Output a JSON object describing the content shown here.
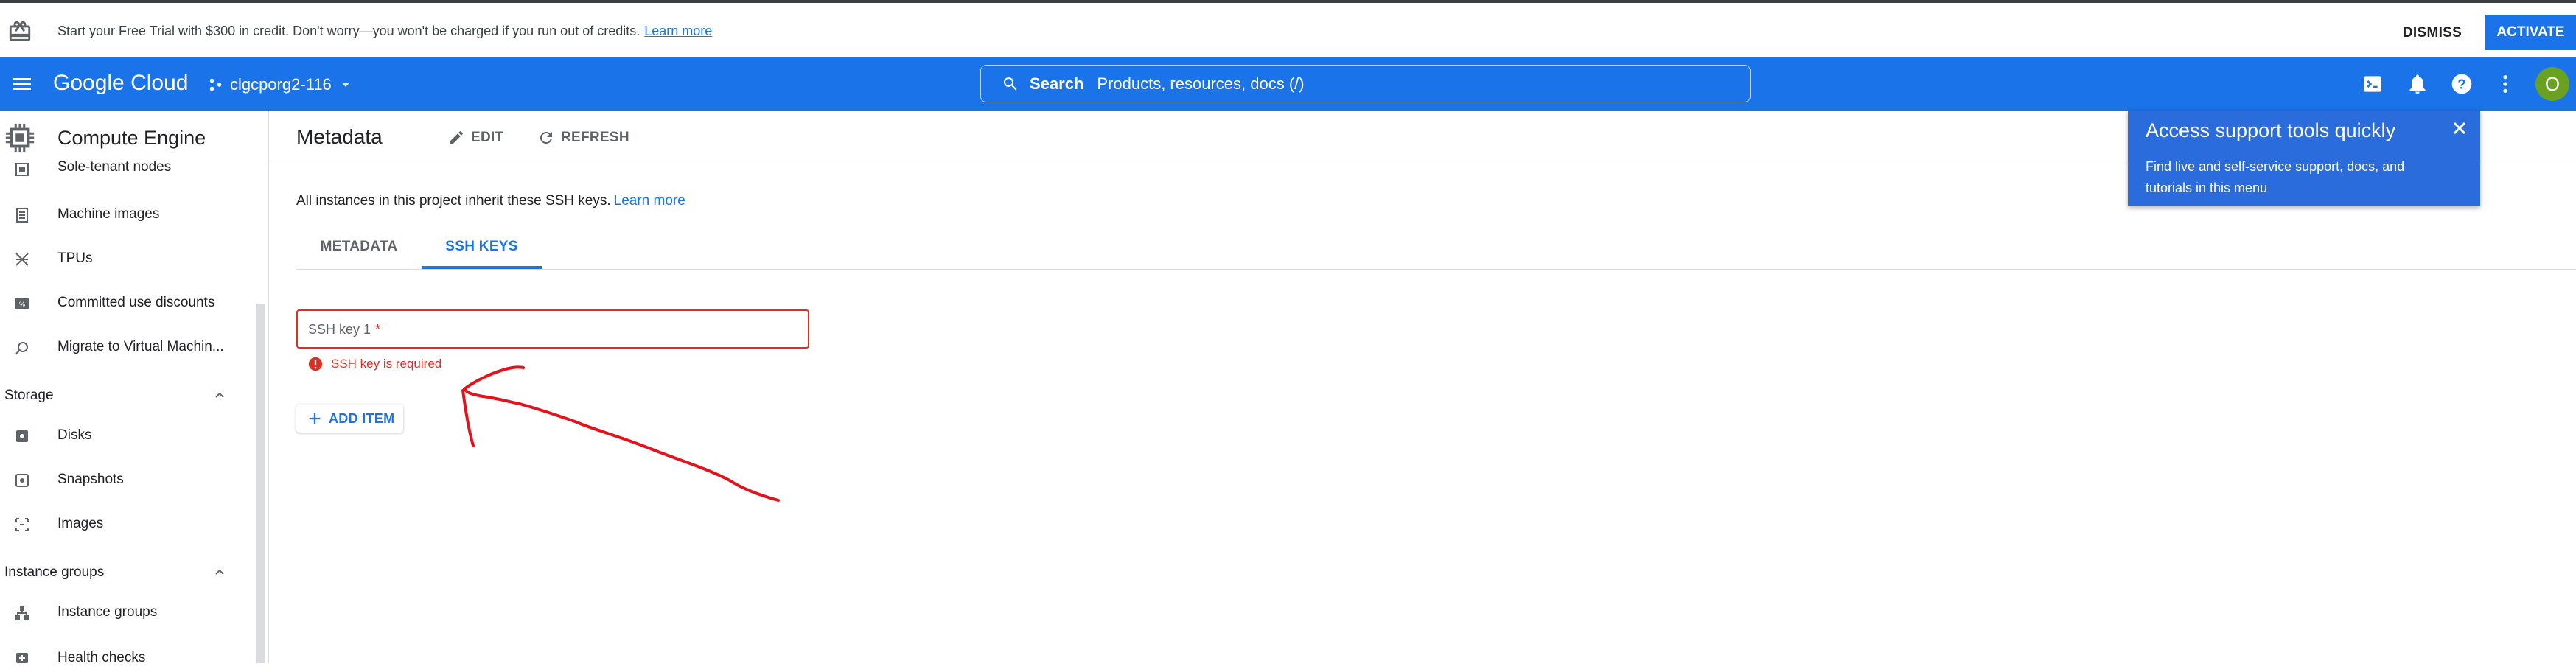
{
  "banner": {
    "message": "Start your Free Trial with $300 in credit. Don't worry—you won't be charged if you run out of credits.",
    "learn_more": "Learn more",
    "dismiss": "DISMISS",
    "activate": "ACTIVATE"
  },
  "header": {
    "logo": "Google Cloud",
    "project": "clgcporg2-116",
    "search_label": "Search",
    "search_placeholder": "Products, resources, docs (/)",
    "avatar_letter": "O"
  },
  "sidebar": {
    "title": "Compute Engine",
    "items": [
      {
        "label": "Sole-tenant nodes",
        "icon": "sole-tenant-icon"
      },
      {
        "label": "Machine images",
        "icon": "machine-images-icon"
      },
      {
        "label": "TPUs",
        "icon": "tpu-icon"
      },
      {
        "label": "Committed use discounts",
        "icon": "discount-icon"
      },
      {
        "label": "Migrate to Virtual Machin...",
        "icon": "migrate-icon"
      }
    ],
    "storage": {
      "label": "Storage",
      "items": [
        {
          "label": "Disks",
          "icon": "disk-icon"
        },
        {
          "label": "Snapshots",
          "icon": "snapshot-icon"
        },
        {
          "label": "Images",
          "icon": "images-icon"
        }
      ]
    },
    "instance_groups": {
      "label": "Instance groups",
      "items": [
        {
          "label": "Instance groups",
          "icon": "instance-groups-icon"
        },
        {
          "label": "Health checks",
          "icon": "health-checks-icon"
        }
      ]
    }
  },
  "main": {
    "title": "Metadata",
    "edit": "EDIT",
    "refresh": "REFRESH",
    "info": "All instances in this project inherit these SSH keys.",
    "info_link": "Learn more",
    "tabs": [
      {
        "label": "METADATA",
        "active": false
      },
      {
        "label": "SSH KEYS",
        "active": true
      }
    ],
    "field_placeholder": "SSH key 1",
    "field_required": "*",
    "error": "SSH key is required",
    "add_item": "ADD ITEM"
  },
  "popup": {
    "title": "Access support tools quickly",
    "body": "Find live and self-service support, docs, and tutorials in this menu"
  },
  "colors": {
    "brand_blue": "#1a73e8",
    "error_red": "#d93025",
    "annotation_red": "#e3121b"
  }
}
